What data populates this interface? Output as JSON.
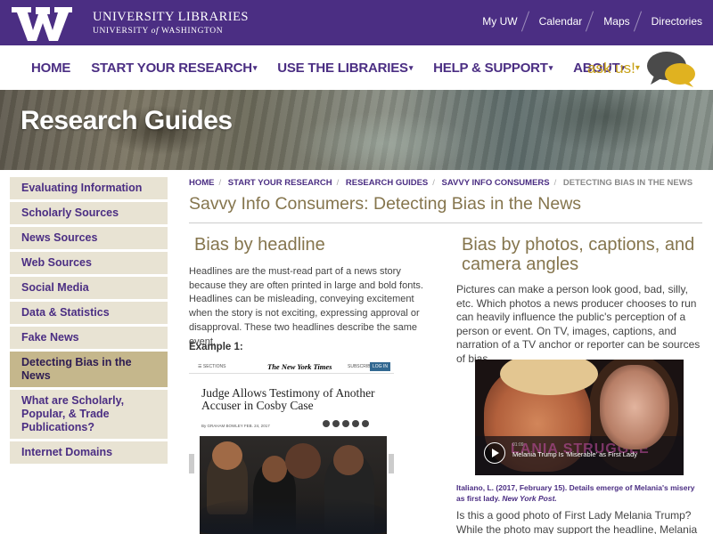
{
  "header": {
    "university_libraries": "UNIVERSITY LIBRARIES",
    "university_of": "UNIVERSITY",
    "university_of_italic": "of",
    "university_of_wash": "WASHINGTON",
    "toplinks": [
      "My UW",
      "Calendar",
      "Maps",
      "Directories"
    ],
    "colors": {
      "purple": "#4b2e83",
      "gold": "#85754d"
    }
  },
  "nav": {
    "items": [
      {
        "label": "HOME",
        "caret": ""
      },
      {
        "label": "START YOUR RESEARCH",
        "caret": "▾"
      },
      {
        "label": "USE THE LIBRARIES",
        "caret": "▾"
      },
      {
        "label": "HELP & SUPPORT",
        "caret": "▾"
      },
      {
        "label": "ABOUT",
        "caret": "▾"
      }
    ],
    "ask_us": "ask us!",
    "ask_caret": "▾"
  },
  "banner": {
    "title": "Research Guides"
  },
  "sidebar": {
    "items": [
      {
        "label": "Evaluating Information"
      },
      {
        "label": "Scholarly Sources"
      },
      {
        "label": "News Sources"
      },
      {
        "label": "Web Sources"
      },
      {
        "label": "Social Media"
      },
      {
        "label": "Data & Statistics"
      },
      {
        "label": "Fake News"
      },
      {
        "label": "Detecting Bias in the News"
      },
      {
        "label": "What are Scholarly, Popular, & Trade Publications?"
      },
      {
        "label": "Internet Domains"
      }
    ],
    "active_index": 7
  },
  "breadcrumb": {
    "items": [
      "HOME",
      "START YOUR RESEARCH",
      "RESEARCH GUIDES",
      "SAVVY INFO CONSUMERS"
    ],
    "current": "DETECTING BIAS IN THE NEWS"
  },
  "page_title": "Savvy Info Consumers: Detecting Bias in the News",
  "left": {
    "heading": "Bias by headline",
    "paragraph": "Headlines are the must-read part of a news story because they are often printed in large and bold fonts.  Headlines can be misleading, conveying excitement when the story is not exciting, expressing approval or disapproval.  These two headlines describe the same event.",
    "example_label": "Example 1:",
    "article": {
      "sections": "☰ SECTIONS",
      "logo": "The New York Times",
      "subscribe": "SUBSCRIBE NOW",
      "login": "LOG IN",
      "headline": "Judge Allows Testimony of Another Accuser in Cosby Case",
      "byline": "By GRAHAM BOWLEY  FEB. 24, 2017"
    }
  },
  "right": {
    "heading": "Bias by photos, captions, and camera angles",
    "paragraph": "Pictures can make a person look good, bad, silly, etc.  Which photos a news producer chooses to run can heavily influence the public's perception of a person or event.  On TV, images, captions, and narration of a TV anchor or reporter can be sources of bias.",
    "video": {
      "time": "01:09",
      "caption": "Melania Trump Is 'Miserable' as First Lady",
      "overlay_text": "LANIA STRUGGLE"
    },
    "citation": "Italiano, L.  (2017, February 15).  Details emerge of Melania's misery as first lady.",
    "citation_source": "New York Post.",
    "paragraph2": "Is this a good photo of First Lady Melania Trump?  While the photo may support the headline, Melania"
  }
}
